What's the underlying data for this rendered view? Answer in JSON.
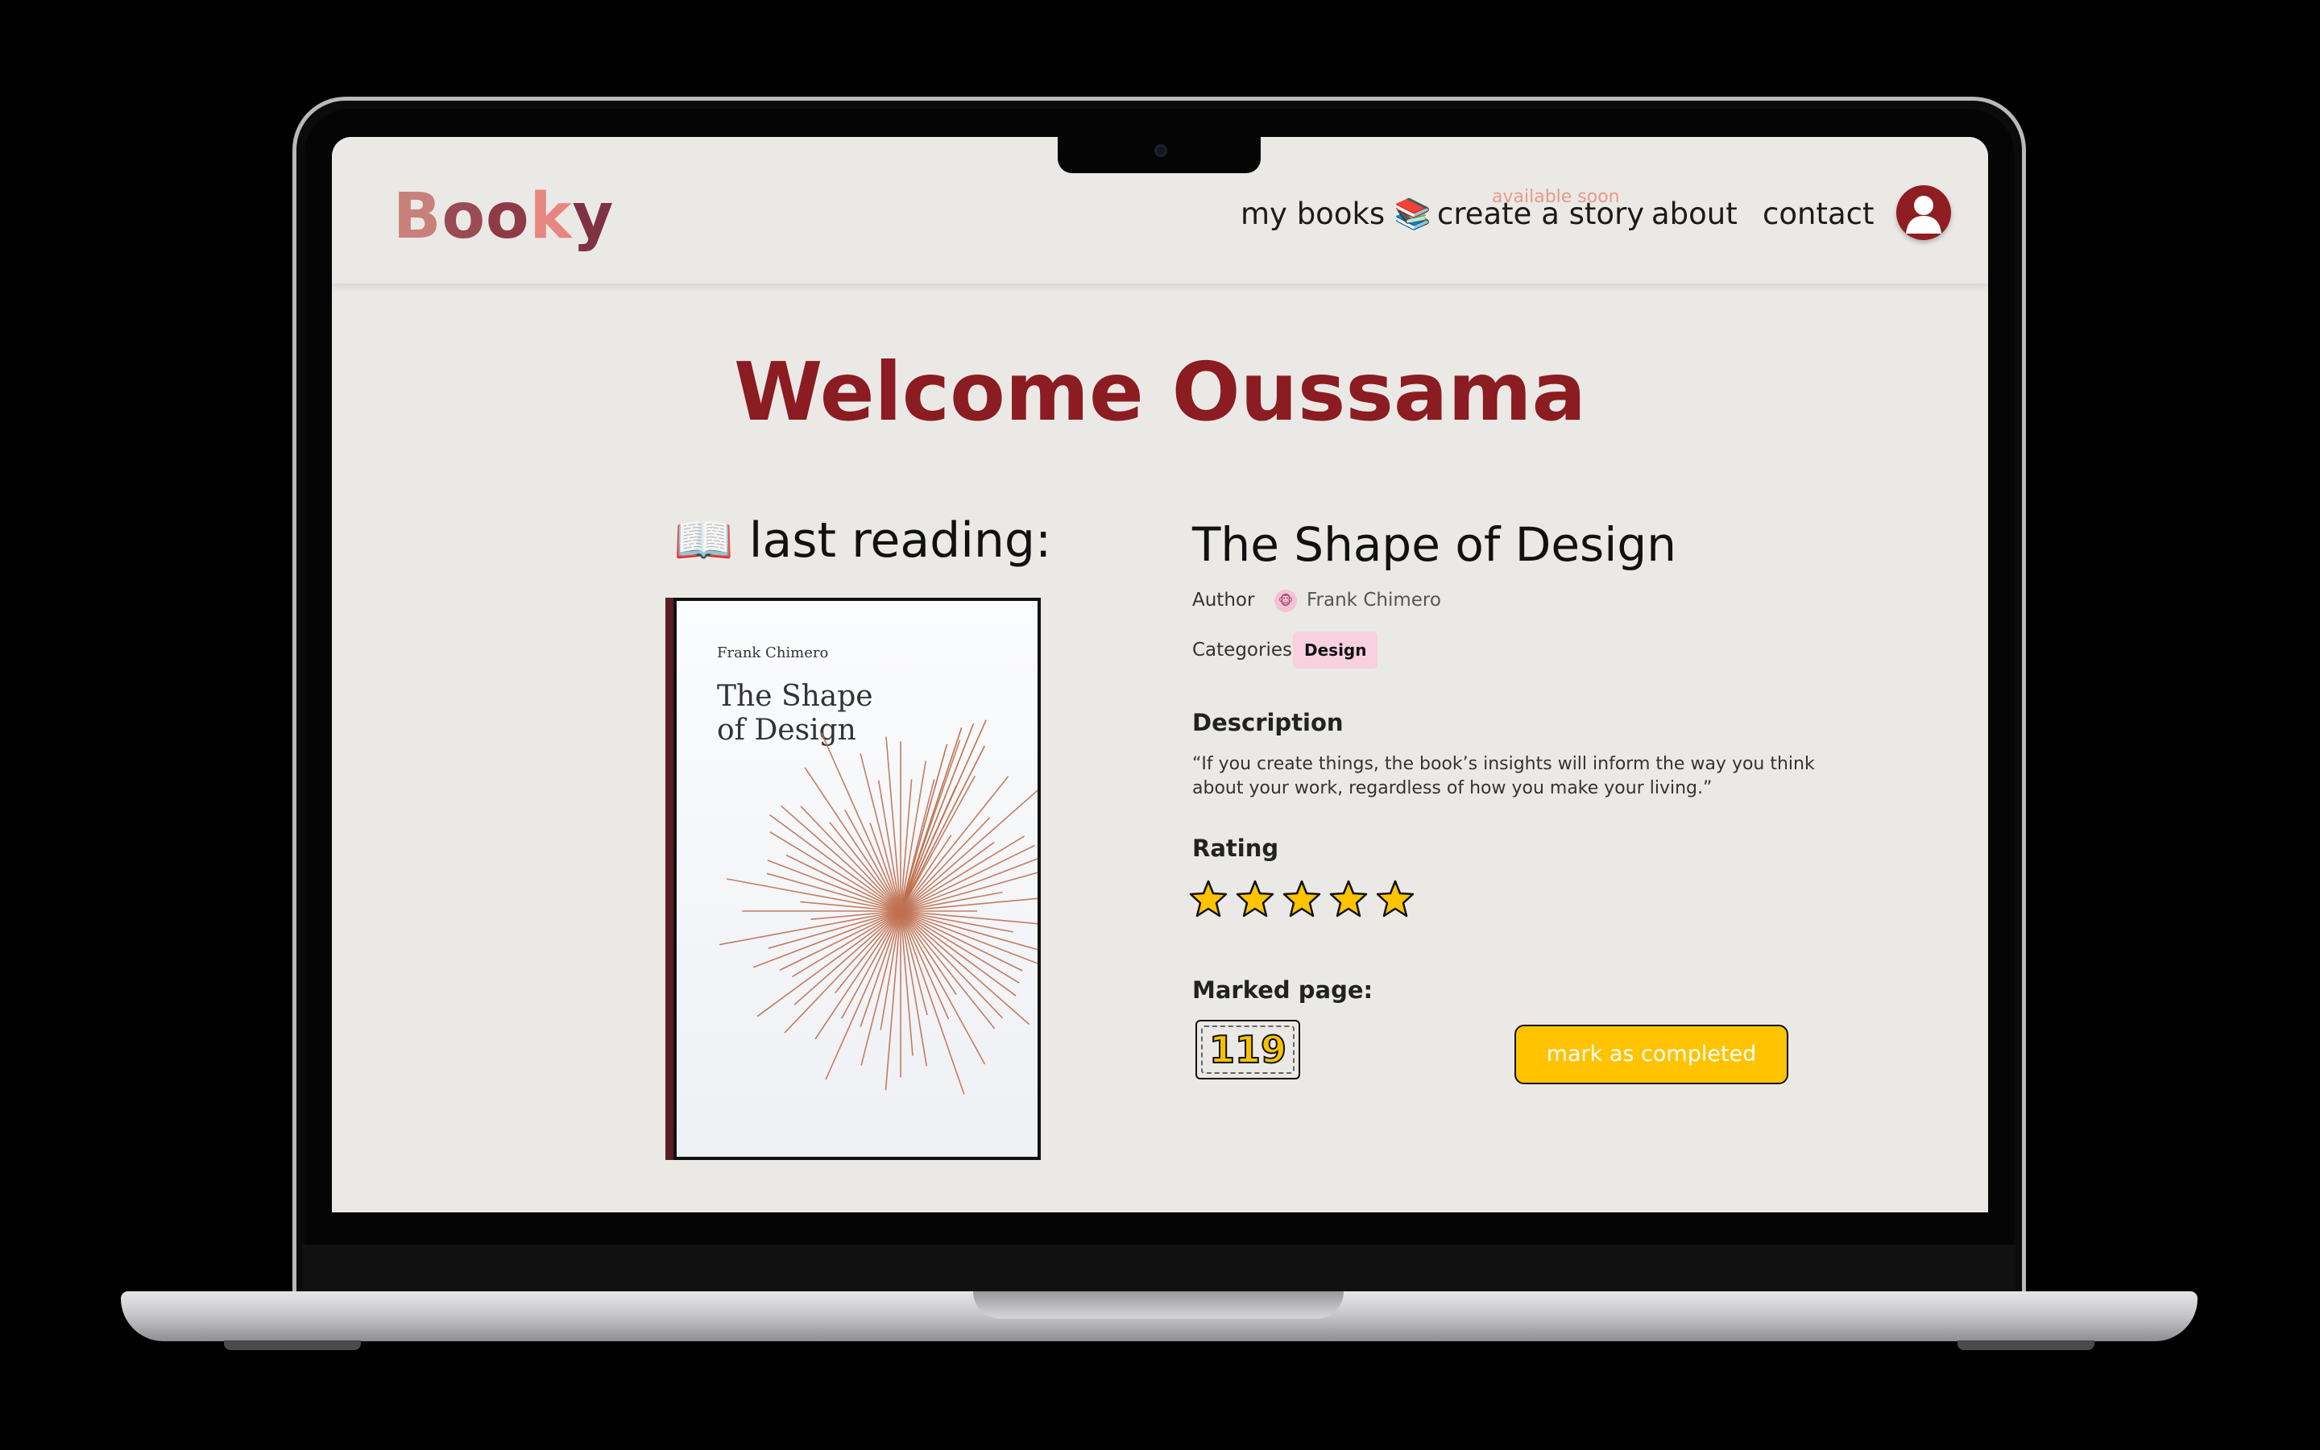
{
  "nav": {
    "logo": {
      "b": "B",
      "o1": "o",
      "o2": "o",
      "k": "k",
      "y": "y"
    },
    "my_books": "my books 📚",
    "create_story": "create a story",
    "available_soon": "available soon",
    "about": "about",
    "contact": "contact"
  },
  "welcome": "Welcome Oussama",
  "last_reading": "📖 last reading:",
  "book": {
    "cover_author": "Frank Chimero",
    "cover_title_line1": "The Shape",
    "cover_title_line2": "of Design",
    "title": "The Shape of Design",
    "author_label": "Author",
    "author_avatar": "🐵",
    "author": "Frank Chimero",
    "categories_label": "Categories",
    "category": "Design",
    "description_heading": "Description",
    "description": "“If you create things, the book’s insights will inform the way you think about your work, regardless of how you make your living.”",
    "rating_heading": "Rating",
    "rating": 5,
    "rating_max": 5,
    "marked_page_heading": "Marked page:",
    "marked_page": "119",
    "complete_button": "mark as completed"
  },
  "colors": {
    "accent": "#8b1c22",
    "button": "#ffc300",
    "badge": "#f8d0df",
    "background": "#ebe9e6"
  }
}
